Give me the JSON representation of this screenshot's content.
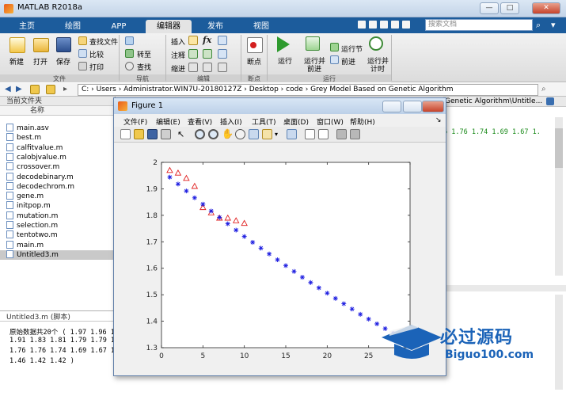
{
  "window": {
    "title": "MATLAB R2018a",
    "min": "—",
    "max": "□",
    "close": "✕"
  },
  "tabs": [
    "主页",
    "绘图",
    "APP",
    "编辑器",
    "发布",
    "视图"
  ],
  "search": {
    "placeholder": "搜索文档"
  },
  "ribbon": {
    "file": {
      "new": "新建",
      "open": "打开",
      "save": "保存",
      "find_files": "查找文件",
      "compare": "比较",
      "print": "打印",
      "group": "文件"
    },
    "nav": {
      "goto": "转至",
      "find": "查找",
      "group": "导航"
    },
    "edit": {
      "insert": "插入",
      "comment": "注释",
      "indent": "缩进",
      "group": "编辑"
    },
    "breakpoints": {
      "label": "断点",
      "group": "断点"
    },
    "run": {
      "run": "运行",
      "run_advance_1": "运行并",
      "run_advance_2": "前进",
      "run_section": "运行节",
      "advance": "前进",
      "run_time_1": "运行并",
      "run_time_2": "计时",
      "group": "运行"
    }
  },
  "address": {
    "path": "C: › Users › Administrator.WIN7U-20180127Z › Desktop › code › Grey Model Based on Genetic Algorithm"
  },
  "current_folder": {
    "header": "当前文件夹",
    "col_name": "名称",
    "files": [
      "main.asv",
      "best.m",
      "calfitvalue.m",
      "calobjvalue.m",
      "crossover.m",
      "decodebinary.m",
      "decodechrom.m",
      "gene.m",
      "initpop.m",
      "mutation.m",
      "selection.m",
      "tentotwo.m",
      "main.m",
      "Untitled3.m"
    ],
    "selected": "Untitled3.m"
  },
  "details": {
    "title": "Untitled3.m  (脚本)"
  },
  "command_window": {
    "lines": [
      "原始数据共20个 ( 1.97 1.96 1.94",
      "1.91 1.83 1.81 1.79 1.79 1.78 1.",
      "1.76 1.76 1.74 1.69 1.67 1.56 1.",
      "1.46 1.42 1.42 )"
    ]
  },
  "editor_right": {
    "path_tail": "Genetic Algorithm\\Untitle...",
    "code": "6 1.76 1.74 1.69 1.67 1."
  },
  "figure": {
    "title": "Figure 1",
    "menu": [
      "文件(F)",
      "编辑(E)",
      "查看(V)",
      "插入(I)",
      "工具(T)",
      "桌面(D)",
      "窗口(W)",
      "帮助(H)"
    ]
  },
  "chart_data": {
    "type": "scatter",
    "xlim": [
      0,
      30
    ],
    "ylim": [
      1.3,
      2
    ],
    "xticks": [
      0,
      5,
      10,
      15,
      20,
      25,
      30
    ],
    "yticks": [
      1.3,
      1.4,
      1.5,
      1.6,
      1.7,
      1.8,
      1.9,
      2
    ],
    "series": [
      {
        "marker": "triangle",
        "color": "#e02020",
        "x": [
          1,
          2,
          3,
          4,
          5,
          6,
          7,
          8,
          9,
          10
        ],
        "y": [
          1.97,
          1.96,
          1.94,
          1.91,
          1.83,
          1.81,
          1.79,
          1.79,
          1.78,
          1.77
        ]
      },
      {
        "marker": "star",
        "color": "#1a1ae0",
        "x": [
          1,
          2,
          3,
          4,
          5,
          6,
          7,
          8,
          9,
          10,
          11,
          12,
          13,
          14,
          15,
          16,
          17,
          18,
          19,
          20,
          21,
          22,
          23,
          24,
          25,
          26,
          27,
          28,
          29,
          30
        ],
        "y": [
          1.944,
          1.918,
          1.892,
          1.866,
          1.842,
          1.816,
          1.792,
          1.768,
          1.744,
          1.72,
          1.698,
          1.676,
          1.654,
          1.632,
          1.61,
          1.588,
          1.566,
          1.546,
          1.526,
          1.506,
          1.486,
          1.466,
          1.446,
          1.426,
          1.408,
          1.39,
          1.372,
          1.354,
          1.336,
          1.318
        ]
      }
    ]
  },
  "watermark": {
    "brand": "必过源码",
    "url": "Biguo100.com"
  }
}
